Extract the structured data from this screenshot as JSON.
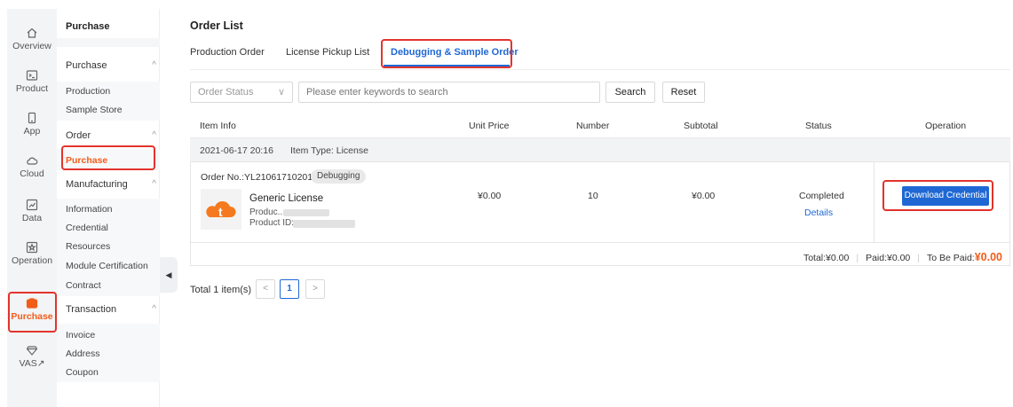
{
  "rail": [
    {
      "label": "Overview",
      "icon": "home-icon"
    },
    {
      "label": "Product",
      "icon": "terminal-icon"
    },
    {
      "label": "App",
      "icon": "phone-icon"
    },
    {
      "label": "Cloud",
      "icon": "cloud-icon"
    },
    {
      "label": "Data",
      "icon": "chart-icon"
    },
    {
      "label": "Operation",
      "icon": "star-box-icon"
    },
    {
      "label": "Purchase",
      "icon": "shop-icon"
    },
    {
      "label": "VAS↗",
      "icon": "diamond-icon"
    }
  ],
  "menu": {
    "header": "Purchase",
    "groups": [
      {
        "label": "Purchase",
        "items": [
          "Production",
          "Sample Store"
        ]
      },
      {
        "label": "Order",
        "items": [
          "Purchase"
        ]
      },
      {
        "label": "Manufacturing",
        "items": [
          "Information",
          "Credential",
          "Resources",
          "Module Certification",
          "Contract"
        ]
      },
      {
        "label": "Transaction",
        "items": [
          "Invoice",
          "Address",
          "Coupon"
        ]
      }
    ]
  },
  "page": {
    "title": "Order List",
    "tabs": [
      "Production Order",
      "License Pickup List",
      "Debugging & Sample Order"
    ],
    "filter": {
      "status_placeholder": "Order Status",
      "search_placeholder": "Please enter keywords to search",
      "search_label": "Search",
      "reset_label": "Reset"
    },
    "columns": [
      "Item Info",
      "Unit Price",
      "Number",
      "Subtotal",
      "Status",
      "Operation"
    ],
    "order": {
      "datetime": "2021-06-17 20:16",
      "item_type": "Item Type: License",
      "order_no": "Order No.:YL2106171020102S",
      "badge": "Debugging",
      "product_name": "Generic License",
      "product_line": "Produc...",
      "product_id_label": "Product ID:",
      "unit_price": "¥0.00",
      "number": "10",
      "subtotal": "¥0.00",
      "status": "Completed",
      "details_label": "Details",
      "download_label": "Download Credential",
      "total": "Total:¥0.00",
      "paid": "Paid:¥0.00",
      "to_be_paid_label": "To Be Paid:",
      "to_be_paid_value": "¥0.00"
    },
    "pagination": {
      "total": "Total 1 item(s)",
      "prev": "<",
      "page": "1",
      "next": ">"
    }
  },
  "colors": {
    "accent": "#1f68d4",
    "brand_orange": "#f25c19",
    "highlight_red": "#e3332c"
  }
}
